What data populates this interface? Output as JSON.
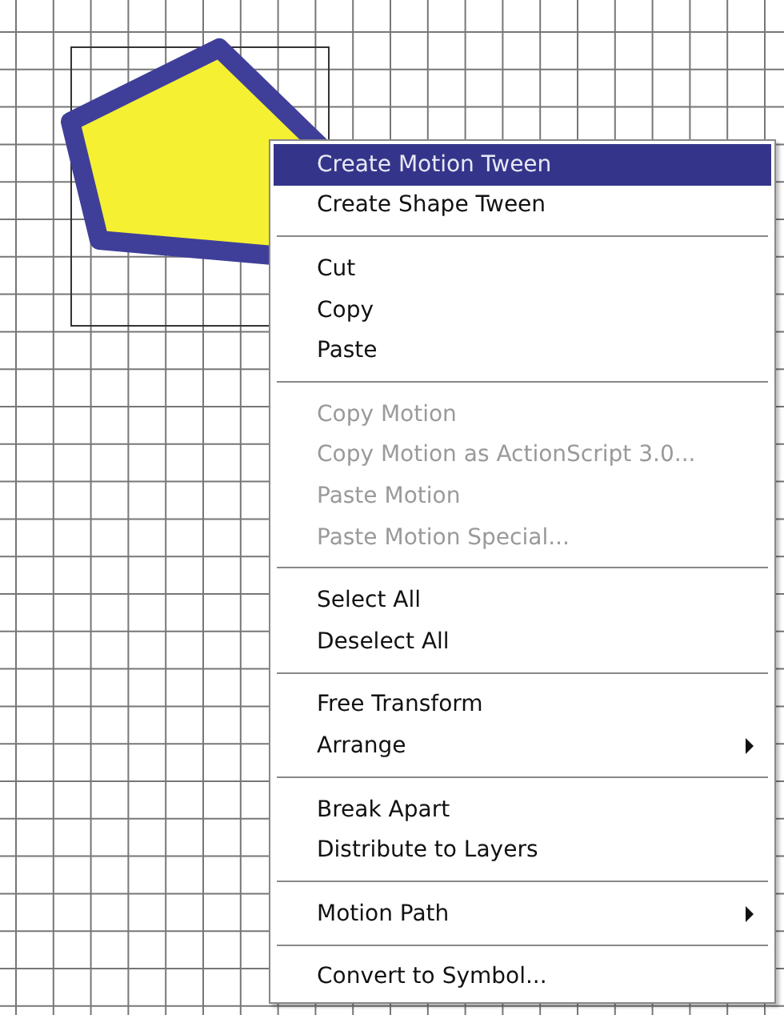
{
  "stage": {
    "shape": {
      "kind": "pentagon",
      "selected": true
    }
  },
  "context_menu": {
    "groups": [
      {
        "items": [
          {
            "label": "Create Motion Tween",
            "selected": true,
            "disabled": false,
            "submenu": false
          },
          {
            "label": "Create Shape Tween",
            "selected": false,
            "disabled": false,
            "submenu": false
          }
        ]
      },
      {
        "items": [
          {
            "label": "Cut",
            "selected": false,
            "disabled": false,
            "submenu": false
          },
          {
            "label": "Copy",
            "selected": false,
            "disabled": false,
            "submenu": false
          },
          {
            "label": "Paste",
            "selected": false,
            "disabled": false,
            "submenu": false
          }
        ]
      },
      {
        "items": [
          {
            "label": "Copy Motion",
            "selected": false,
            "disabled": true,
            "submenu": false
          },
          {
            "label": "Copy Motion as ActionScript 3.0...",
            "selected": false,
            "disabled": true,
            "submenu": false
          },
          {
            "label": "Paste Motion",
            "selected": false,
            "disabled": true,
            "submenu": false
          },
          {
            "label": "Paste Motion Special...",
            "selected": false,
            "disabled": true,
            "submenu": false
          }
        ]
      },
      {
        "items": [
          {
            "label": "Select All",
            "selected": false,
            "disabled": false,
            "submenu": false
          },
          {
            "label": "Deselect All",
            "selected": false,
            "disabled": false,
            "submenu": false
          }
        ]
      },
      {
        "items": [
          {
            "label": "Free Transform",
            "selected": false,
            "disabled": false,
            "submenu": false
          },
          {
            "label": "Arrange",
            "selected": false,
            "disabled": false,
            "submenu": true
          }
        ]
      },
      {
        "items": [
          {
            "label": "Break Apart",
            "selected": false,
            "disabled": false,
            "submenu": false
          },
          {
            "label": "Distribute to Layers",
            "selected": false,
            "disabled": false,
            "submenu": false
          }
        ]
      },
      {
        "items": [
          {
            "label": "Motion Path",
            "selected": false,
            "disabled": false,
            "submenu": true
          }
        ]
      },
      {
        "items": [
          {
            "label": "Convert to Symbol...",
            "selected": false,
            "disabled": false,
            "submenu": false
          }
        ]
      }
    ]
  }
}
